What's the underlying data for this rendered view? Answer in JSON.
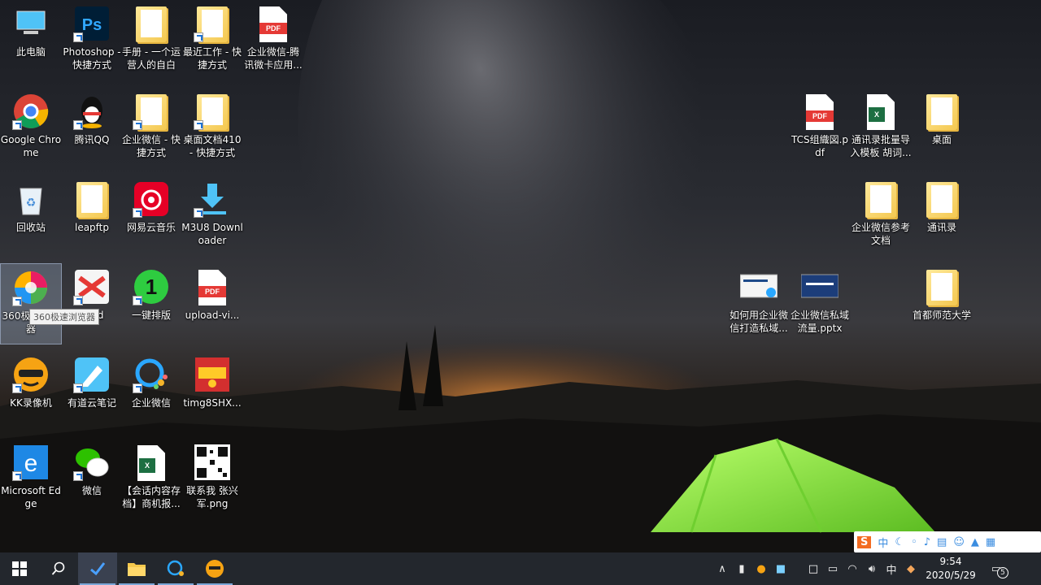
{
  "desktop": {
    "icons": [
      {
        "name": "此电脑",
        "kind": "computer"
      },
      {
        "name": "Photoshop - 快捷方式",
        "kind": "ps"
      },
      {
        "name": "手册 - 一个运营人的自白",
        "kind": "folder"
      },
      {
        "name": "最近工作 - 快捷方式",
        "kind": "folder"
      },
      {
        "name": "企业微信-腾讯微卡应用...",
        "kind": "pdf"
      },
      {
        "name": "Google Chrome",
        "kind": "chrome"
      },
      {
        "name": "腾讯QQ",
        "kind": "qq"
      },
      {
        "name": "企业微信 - 快捷方式",
        "kind": "folder"
      },
      {
        "name": "桌面文档410 - 快捷方式",
        "kind": "folder"
      },
      {
        "name": "回收站",
        "kind": "recycle"
      },
      {
        "name": "leapftp",
        "kind": "folder"
      },
      {
        "name": "网易云音乐",
        "kind": "netease"
      },
      {
        "name": "M3U8 Downloader",
        "kind": "download"
      },
      {
        "name": "360极速浏览器",
        "kind": "360"
      },
      {
        "name": "Mind",
        "kind": "xmind"
      },
      {
        "name": "一键排版",
        "kind": "one"
      },
      {
        "name": "upload-vi...",
        "kind": "pdf"
      },
      {
        "name": "KK录像机",
        "kind": "kk"
      },
      {
        "name": "有道云笔记",
        "kind": "youdao"
      },
      {
        "name": "企业微信",
        "kind": "wework"
      },
      {
        "name": "timg8SHX...",
        "kind": "redpacket"
      },
      {
        "name": "Microsoft Edge",
        "kind": "edge"
      },
      {
        "name": "微信",
        "kind": "wechat"
      },
      {
        "name": "【会话内容存档】商机报...",
        "kind": "excel"
      },
      {
        "name": "联系我 张兴军.png",
        "kind": "qr"
      },
      {
        "name": "TCS组織図.pdf",
        "kind": "pdf"
      },
      {
        "name": "通讯录批量导入模板 胡词...",
        "kind": "excel"
      },
      {
        "name": "桌面",
        "kind": "folder"
      },
      {
        "name": "企业微信参考文档",
        "kind": "folder"
      },
      {
        "name": "通讯录",
        "kind": "folder"
      },
      {
        "name": "如何用企业微信打造私域...",
        "kind": "pptthumb"
      },
      {
        "name": "企业微信私域流量.pptx",
        "kind": "pptthumb2"
      },
      {
        "name": "首都师范大学",
        "kind": "folder"
      }
    ],
    "tooltip": "360极速浏览器"
  },
  "ime": {
    "lang_label": "中"
  },
  "taskbar": {
    "ime_label": "中",
    "time": "9:54",
    "date": "2020/5/29",
    "notification_count": "5"
  },
  "colors": {
    "taskbar": "#23272d",
    "accent": "#7aa7d8",
    "tent": "#8ee04a"
  }
}
